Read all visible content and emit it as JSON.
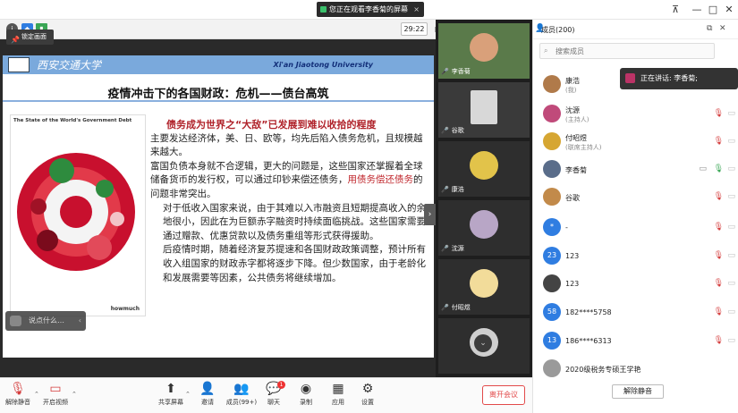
{
  "titlebar": {
    "share_banner": "您正在观看李香菊的屏幕",
    "close_glyph": "×",
    "pin_glyph": "⊼",
    "minimize_glyph": "—",
    "maximize_glyph": "□",
    "window_close_glyph": "✕"
  },
  "viewer_toolbar": {
    "time": "29:22",
    "view_mode": "演讲者视图"
  },
  "lock_screen_label": "锁定画面",
  "slide": {
    "logo_cn": "西安交通大学",
    "logo_en": "Xi'an Jiaotong University",
    "title": "疫情冲击下的各国财政：危机——债台高筑",
    "chart_title": "The State of the World's Government Debt",
    "chart_brand": "howmuch",
    "headline": "债务成为世界之“大敌”已发展到难以收拾的程度",
    "p1": "主要发达经济体，美、日、欧等，均先后陷入债务危机，且规模越来越大。",
    "p2_a": "富国负债本身就不合逻辑，更大的问题是，这些国家还掌握着全球储备货币的发行权，可以通过印钞来偿还债务，",
    "p2_red": "用债务偿还债务",
    "p2_b": "的问题非常突出。",
    "p3": "对于低收入国家来说，由于其难以入市融资且短期提高收入的余地很小，因此在为巨额赤字融资时持续面临挑战。这些国家需要通过赠款、优惠贷款以及债务重组等形式获得援助。",
    "p4": "后疫情时期，随着经济复苏提速和各国财政政策调整，预计所有收入组国家的财政赤字都将逐步下降。但少数国家，由于老龄化和发展需要等因素，公共债务将继续增加。"
  },
  "comment_placeholder": "说点什么…",
  "video_strip": {
    "tiles": [
      {
        "name": "李香菊"
      },
      {
        "name": "谷歌"
      },
      {
        "name": "康浩"
      },
      {
        "name": "沈源"
      },
      {
        "name": "付昭煜"
      }
    ]
  },
  "panel": {
    "title": "成员(200)",
    "search_placeholder": "搜索成员",
    "members": [
      {
        "name": "康浩",
        "role": "(我)",
        "avatar": "",
        "color": "#b07a4a"
      },
      {
        "name": "沈源",
        "role": "(主持人)",
        "avatar": "",
        "color": "#c04a7a"
      },
      {
        "name": "付昭煜",
        "role": "(联席主持人)",
        "avatar": "",
        "color": "#d6a632"
      },
      {
        "name": "李香菊",
        "role": "",
        "avatar": "",
        "color": "#5a6d8a"
      },
      {
        "name": "谷歌",
        "role": "",
        "avatar": "",
        "color": "#c28a4a"
      },
      {
        "name": "-",
        "role": "",
        "avatar": "*",
        "color": "#2f7de1"
      },
      {
        "name": "123",
        "role": "",
        "avatar": "23",
        "color": "#2f7de1"
      },
      {
        "name": "123",
        "role": "",
        "avatar": "",
        "color": "#444444"
      },
      {
        "name": "182****5758",
        "role": "",
        "avatar": "58",
        "color": "#2f7de1"
      },
      {
        "name": "186****6313",
        "role": "",
        "avatar": "13",
        "color": "#2f7de1"
      },
      {
        "name": "2020级税务专硕王学艳",
        "role": "",
        "avatar": "",
        "color": "#9a9a9a"
      }
    ],
    "speaking_tip": "正在讲话: 李香菊;",
    "unmute_all": "解除静音"
  },
  "bottombar": {
    "unmute": "解除静音",
    "video": "开启视频",
    "share": "共享屏幕",
    "invite": "邀请",
    "members": "成员(99+)",
    "chat": "聊天",
    "chat_badge": "1",
    "record": "录制",
    "apps": "应用",
    "settings": "设置",
    "leave": "离开会议"
  },
  "colors": {
    "accent_blue": "#2f7de1",
    "danger_red": "#e24a4a",
    "slide_header_blue": "#7aa9dc"
  }
}
